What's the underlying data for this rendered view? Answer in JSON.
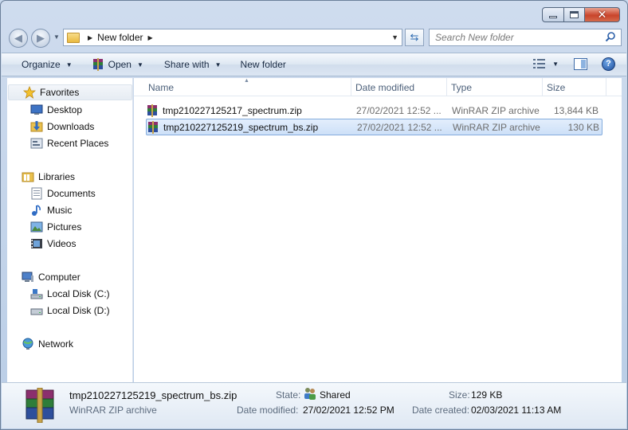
{
  "address": {
    "current_folder": "New folder"
  },
  "search": {
    "placeholder": "Search New folder"
  },
  "toolbar": {
    "organize": "Organize",
    "open": "Open",
    "share_with": "Share with",
    "new_folder": "New folder"
  },
  "nav": {
    "favorites": "Favorites",
    "desktop": "Desktop",
    "downloads": "Downloads",
    "recent_places": "Recent Places",
    "libraries": "Libraries",
    "documents": "Documents",
    "music": "Music",
    "pictures": "Pictures",
    "videos": "Videos",
    "computer": "Computer",
    "local_c": "Local Disk (C:)",
    "local_d": "Local Disk (D:)",
    "network": "Network"
  },
  "columns": {
    "name": "Name",
    "date_modified": "Date modified",
    "type": "Type",
    "size": "Size"
  },
  "files": [
    {
      "name": "tmp210227125217_spectrum.zip",
      "date": "27/02/2021 12:52 ...",
      "type": "WinRAR ZIP archive",
      "size": "13,844 KB",
      "selected": false
    },
    {
      "name": "tmp210227125219_spectrum_bs.zip",
      "date": "27/02/2021 12:52 ...",
      "type": "WinRAR ZIP archive",
      "size": "130 KB",
      "selected": true
    }
  ],
  "details": {
    "name": "tmp210227125219_spectrum_bs.zip",
    "type": "WinRAR ZIP archive",
    "state_label": "State:",
    "state_value": "Shared",
    "date_modified_label": "Date modified:",
    "date_modified_value": "27/02/2021 12:52 PM",
    "size_label": "Size:",
    "size_value": "129 KB",
    "date_created_label": "Date created:",
    "date_created_value": "02/03/2021 11:13 AM"
  }
}
